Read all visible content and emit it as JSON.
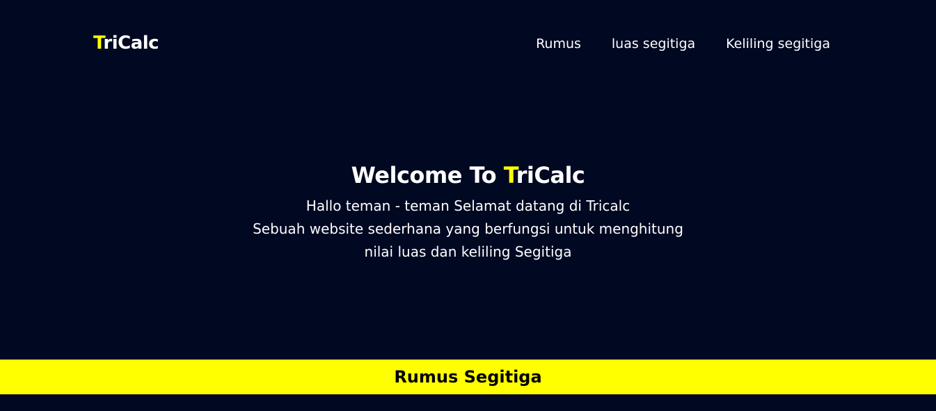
{
  "brand": {
    "accent_letter": "T",
    "rest": "riCalc"
  },
  "nav": {
    "links": [
      {
        "label": "Rumus"
      },
      {
        "label": "luas segitiga"
      },
      {
        "label": "Keliling segitiga"
      }
    ]
  },
  "hero": {
    "title_prefix": "Welcome To ",
    "title_accent": "T",
    "title_rest": "riCalc",
    "lines": [
      "Hallo teman - teman Selamat datang di Tricalc",
      "Sebuah website sederhana yang berfungsi untuk menghitung",
      "nilai luas dan keliling Segitiga"
    ]
  },
  "section": {
    "title": "Rumus Segitiga"
  },
  "colors": {
    "background": "#000822",
    "accent": "#ffff00",
    "text": "#ffffff"
  }
}
